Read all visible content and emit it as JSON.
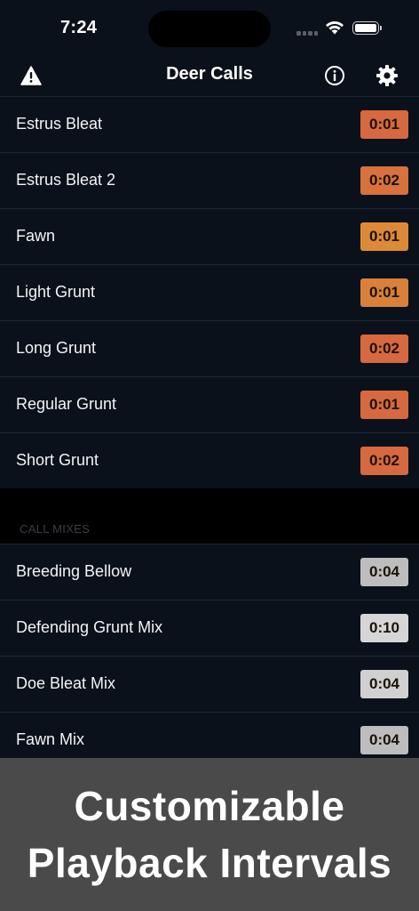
{
  "status_bar": {
    "time": "7:24"
  },
  "nav": {
    "title": "Deer Calls"
  },
  "colors": {
    "orange": "#d97a3a",
    "orange_deep": "#d8673f",
    "gray_badge": "#bdbdbd",
    "gray_light": "#d4d4d4"
  },
  "calls": [
    {
      "label": "Estrus Bleat",
      "duration": "0:01",
      "color": "#d6693f"
    },
    {
      "label": "Estrus Bleat 2",
      "duration": "0:02",
      "color": "#d8713c"
    },
    {
      "label": "Fawn",
      "duration": "0:01",
      "color": "#dd8a38"
    },
    {
      "label": "Light Grunt",
      "duration": "0:01",
      "color": "#d9803a"
    },
    {
      "label": "Long Grunt",
      "duration": "0:02",
      "color": "#d6693f"
    },
    {
      "label": "Regular Grunt",
      "duration": "0:01",
      "color": "#d6693f"
    },
    {
      "label": "Short Grunt",
      "duration": "0:02",
      "color": "#d6693f"
    }
  ],
  "section": {
    "header": "CALL MIXES"
  },
  "mixes": [
    {
      "label": "Breeding Bellow",
      "duration": "0:04",
      "color": "#bdbdbd"
    },
    {
      "label": "Defending Grunt Mix",
      "duration": "0:10",
      "color": "#d6d6d6"
    },
    {
      "label": "Doe Bleat Mix",
      "duration": "0:04",
      "color": "#d0d0d0"
    },
    {
      "label": "Fawn Mix",
      "duration": "0:04",
      "color": "#bdbdbd"
    }
  ],
  "banner": {
    "line1": "Customizable",
    "line2": "Playback Intervals"
  }
}
